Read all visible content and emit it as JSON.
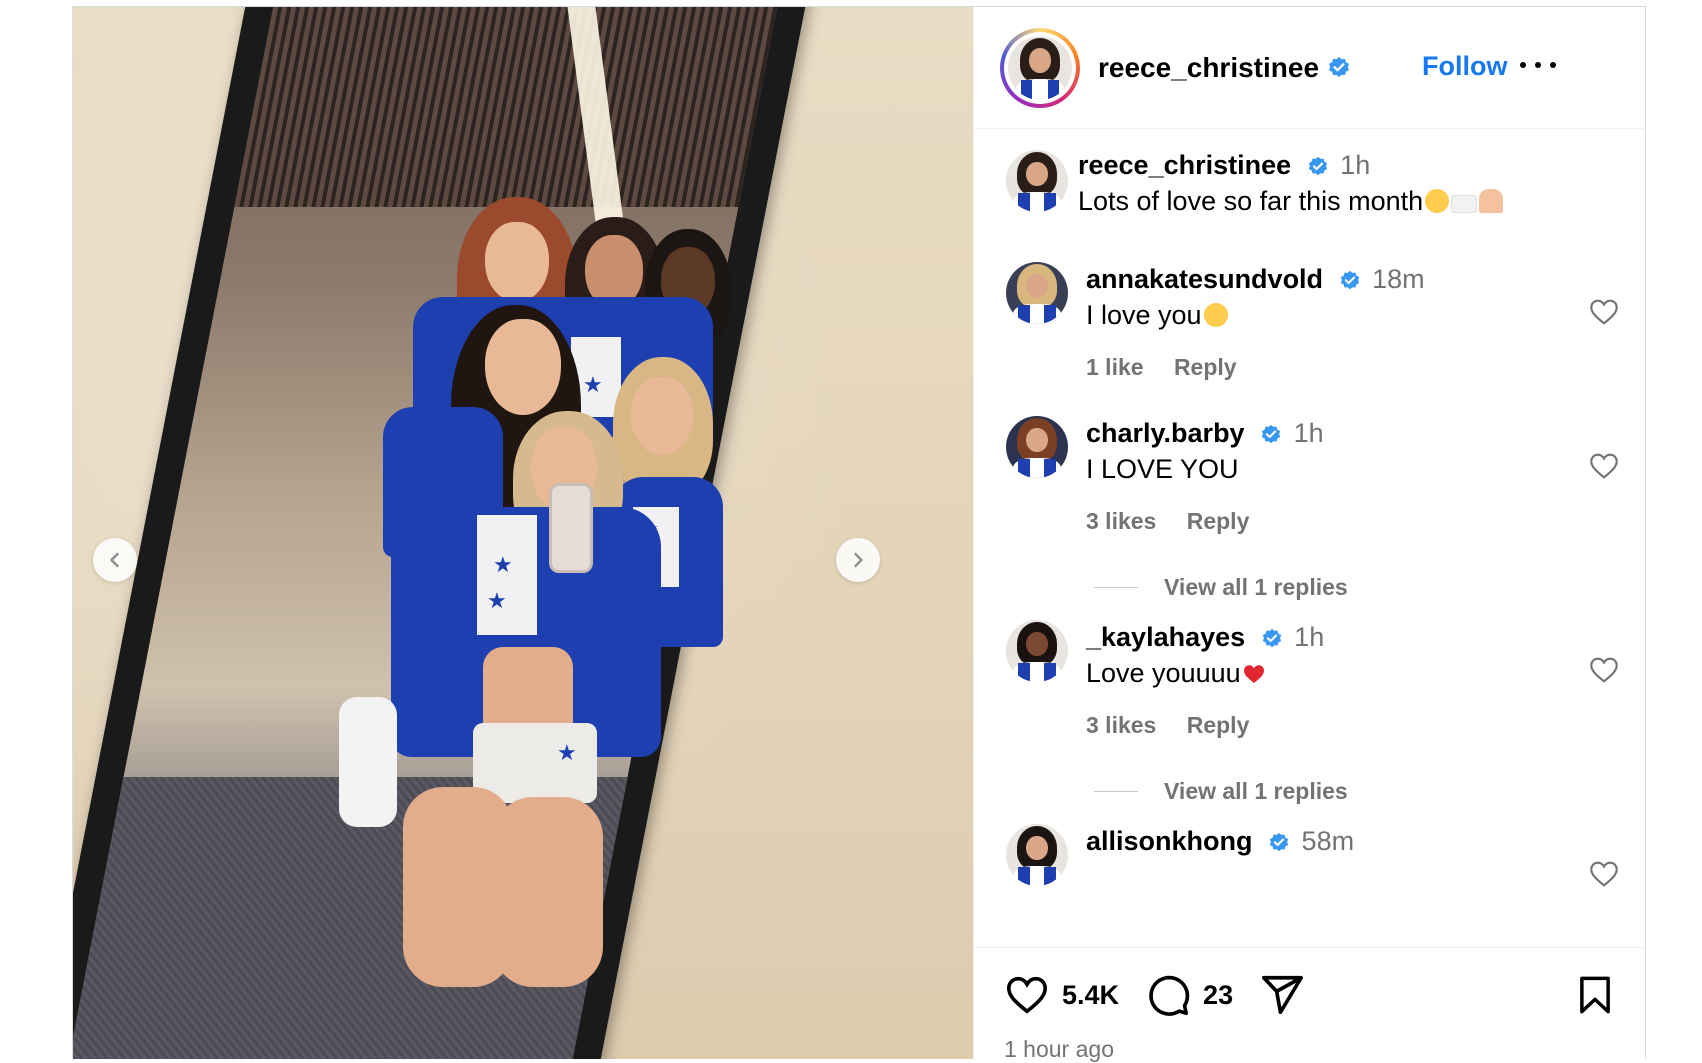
{
  "post": {
    "author": "reece_christinee",
    "follow_label": "Follow",
    "caption": {
      "author": "reece_christinee",
      "time": "1h",
      "text": "Lots of love so far this month"
    }
  },
  "comments": [
    {
      "user": "annakatesundvold",
      "time": "18m",
      "text": "I love you",
      "likes": "1 like",
      "reply": "Reply"
    },
    {
      "user": "charly.barby",
      "time": "1h",
      "text": "I LOVE YOU",
      "likes": "3 likes",
      "reply": "Reply",
      "view_replies": "View all 1 replies"
    },
    {
      "user": "_kaylahayes",
      "time": "1h",
      "text": "Love youuuu",
      "likes": "3 likes",
      "reply": "Reply",
      "view_replies": "View all 1 replies"
    },
    {
      "user": "allisonkhong",
      "time": "58m"
    }
  ],
  "footer": {
    "likes": "5.4K",
    "comments": "23",
    "posted": "1 hour ago"
  },
  "colors": {
    "accent": "#1877f2",
    "verified": "#3897f0",
    "muted": "#737373",
    "uniform_blue": "#1e3fb0"
  },
  "icons": [
    "chevron-left-icon",
    "chevron-right-icon",
    "verified-badge-icon",
    "more-icon",
    "heart-icon",
    "comment-icon",
    "share-icon",
    "bookmark-icon"
  ]
}
